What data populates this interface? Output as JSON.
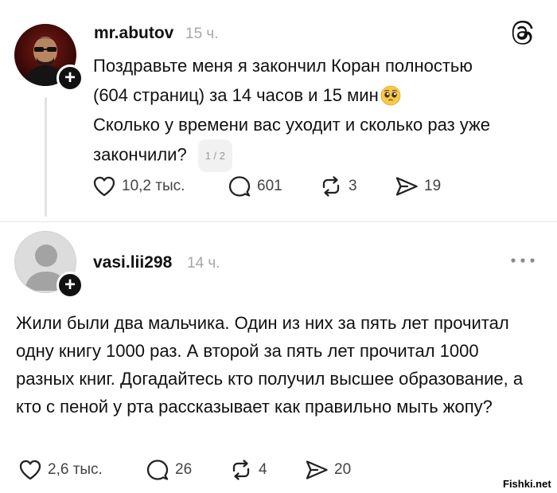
{
  "post1": {
    "username": "mr.abutov",
    "time": "15 ч.",
    "text_line1": "Поздравьте меня я закончил Коран полностью",
    "text_line2": "(604 страниц) за 14 часов и 15 мин",
    "text_line3": "Сколько у времени вас уходит и сколько раз уже",
    "text_line4": "закончили?",
    "page_indicator": "1 / 2",
    "likes": "10,2 тыс.",
    "comments": "601",
    "reposts": "3",
    "shares": "19"
  },
  "post2": {
    "username": "vasi.lii298",
    "time": "14 ч.",
    "text": "Жили были два мальчика. Один из них за пять лет прочитал одну книгу 1000 раз. А второй за пять лет прочитал 1000 разных книг. Догадайтесь кто получил высшее образование, а кто с пеной у рта рассказывает как правильно мыть жопу?",
    "likes": "2,6 тыс.",
    "comments": "26",
    "reposts": "4",
    "shares": "20"
  },
  "watermark": "Fishki.net",
  "icons": {
    "like": "heart-icon",
    "comment": "comment-bubble-icon",
    "repost": "repost-icon",
    "share": "send-icon",
    "threads": "threads-logo-icon",
    "more": "more-dots-icon",
    "follow": "plus-icon"
  }
}
